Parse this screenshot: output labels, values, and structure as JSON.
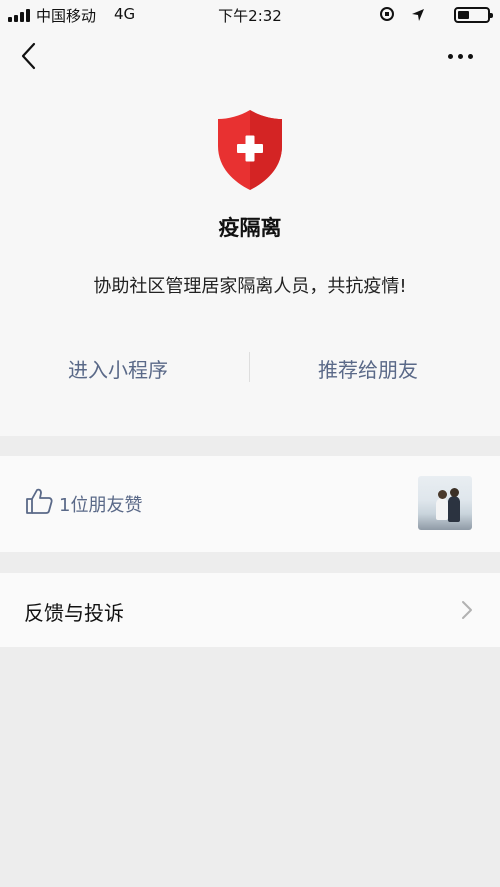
{
  "status_bar": {
    "carrier": "中国移动",
    "network": "4G",
    "time": "下午2:32"
  },
  "nav": {
    "back_icon": "chevron-left-icon",
    "more_icon": "more-dots-icon"
  },
  "app": {
    "icon": "shield-cross-icon",
    "icon_color": "#e83131",
    "name": "疫隔离",
    "description": "协助社区管理居家隔离人员，共抗疫情!",
    "enter_label": "进入小程序",
    "share_label": "推荐给朋友",
    "action_color": "#5a6988"
  },
  "likes": {
    "icon": "thumbs-up-icon",
    "text": "1位朋友赞"
  },
  "feedback": {
    "label": "反馈与投诉",
    "arrow_icon": "chevron-right-icon"
  }
}
